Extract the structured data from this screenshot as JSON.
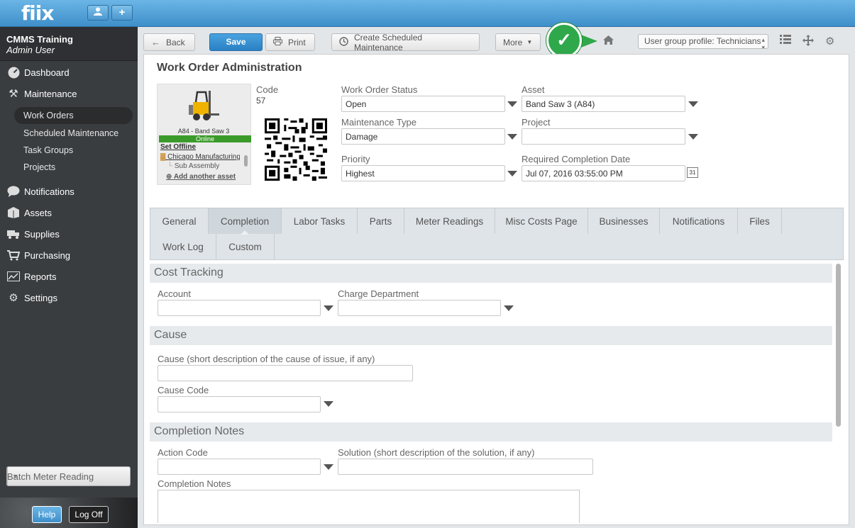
{
  "app": {
    "logo": "fiix",
    "top_buttons": [
      "user-icon",
      "plus-icon"
    ]
  },
  "sidebar": {
    "title": "CMMS Training",
    "subtitle": "Admin User",
    "items": [
      {
        "label": "Dashboard",
        "icon": "dashboard-icon"
      },
      {
        "label": "Maintenance",
        "icon": "tools-icon"
      },
      {
        "label": "Notifications",
        "icon": "speech-bubble-icon"
      },
      {
        "label": "Assets",
        "icon": "assets-icon"
      },
      {
        "label": "Supplies",
        "icon": "truck-icon"
      },
      {
        "label": "Purchasing",
        "icon": "cart-icon"
      },
      {
        "label": "Reports",
        "icon": "chart-icon"
      },
      {
        "label": "Settings",
        "icon": "gear-icon"
      }
    ],
    "maintenance_sub": [
      "Work Orders",
      "Scheduled Maintenance",
      "Task Groups",
      "Projects"
    ],
    "batch_button": "Batch Meter Reading",
    "help": "Help",
    "logoff": "Log Off"
  },
  "toolbar": {
    "back": "Back",
    "save": "Save",
    "print": "Print",
    "create_sm": "Create Scheduled Maintenance",
    "more": "More",
    "profile": "User group profile: Technicians"
  },
  "form": {
    "title": "Work Order Administration",
    "asset_card": {
      "name": "A84 - Band Saw 3",
      "status": "Online",
      "set_offline": "Set Offline",
      "location": "Chicago Manufacturing",
      "sub": "Sub Assembly",
      "add": "Add another asset"
    },
    "code_label": "Code",
    "code_value": "57",
    "wo_status_label": "Work Order Status",
    "wo_status_value": "Open",
    "maint_type_label": "Maintenance Type",
    "maint_type_value": "Damage",
    "priority_label": "Priority",
    "priority_value": "Highest",
    "asset_label": "Asset",
    "asset_value": "Band Saw 3 (A84)",
    "project_label": "Project",
    "project_value": "",
    "rcd_label": "Required Completion Date",
    "rcd_value": "Jul 07, 2016 03:55:00 PM",
    "calendar_day": "31"
  },
  "tabs": {
    "row1": [
      "General",
      "Completion",
      "Labor Tasks",
      "Parts",
      "Meter Readings",
      "Misc Costs Page",
      "Businesses",
      "Notifications",
      "Files"
    ],
    "row2": [
      "Work Log",
      "Custom"
    ],
    "active": "Completion"
  },
  "completion": {
    "cost_tracking": "Cost Tracking",
    "account_label": "Account",
    "charge_dept_label": "Charge Department",
    "cause": "Cause",
    "cause_desc_label": "Cause (short description of the cause of issue, if any)",
    "cause_code_label": "Cause Code",
    "completion_notes": "Completion Notes",
    "action_code_label": "Action Code",
    "solution_label": "Solution (short description of the solution, if any)",
    "completion_notes_label": "Completion Notes"
  }
}
